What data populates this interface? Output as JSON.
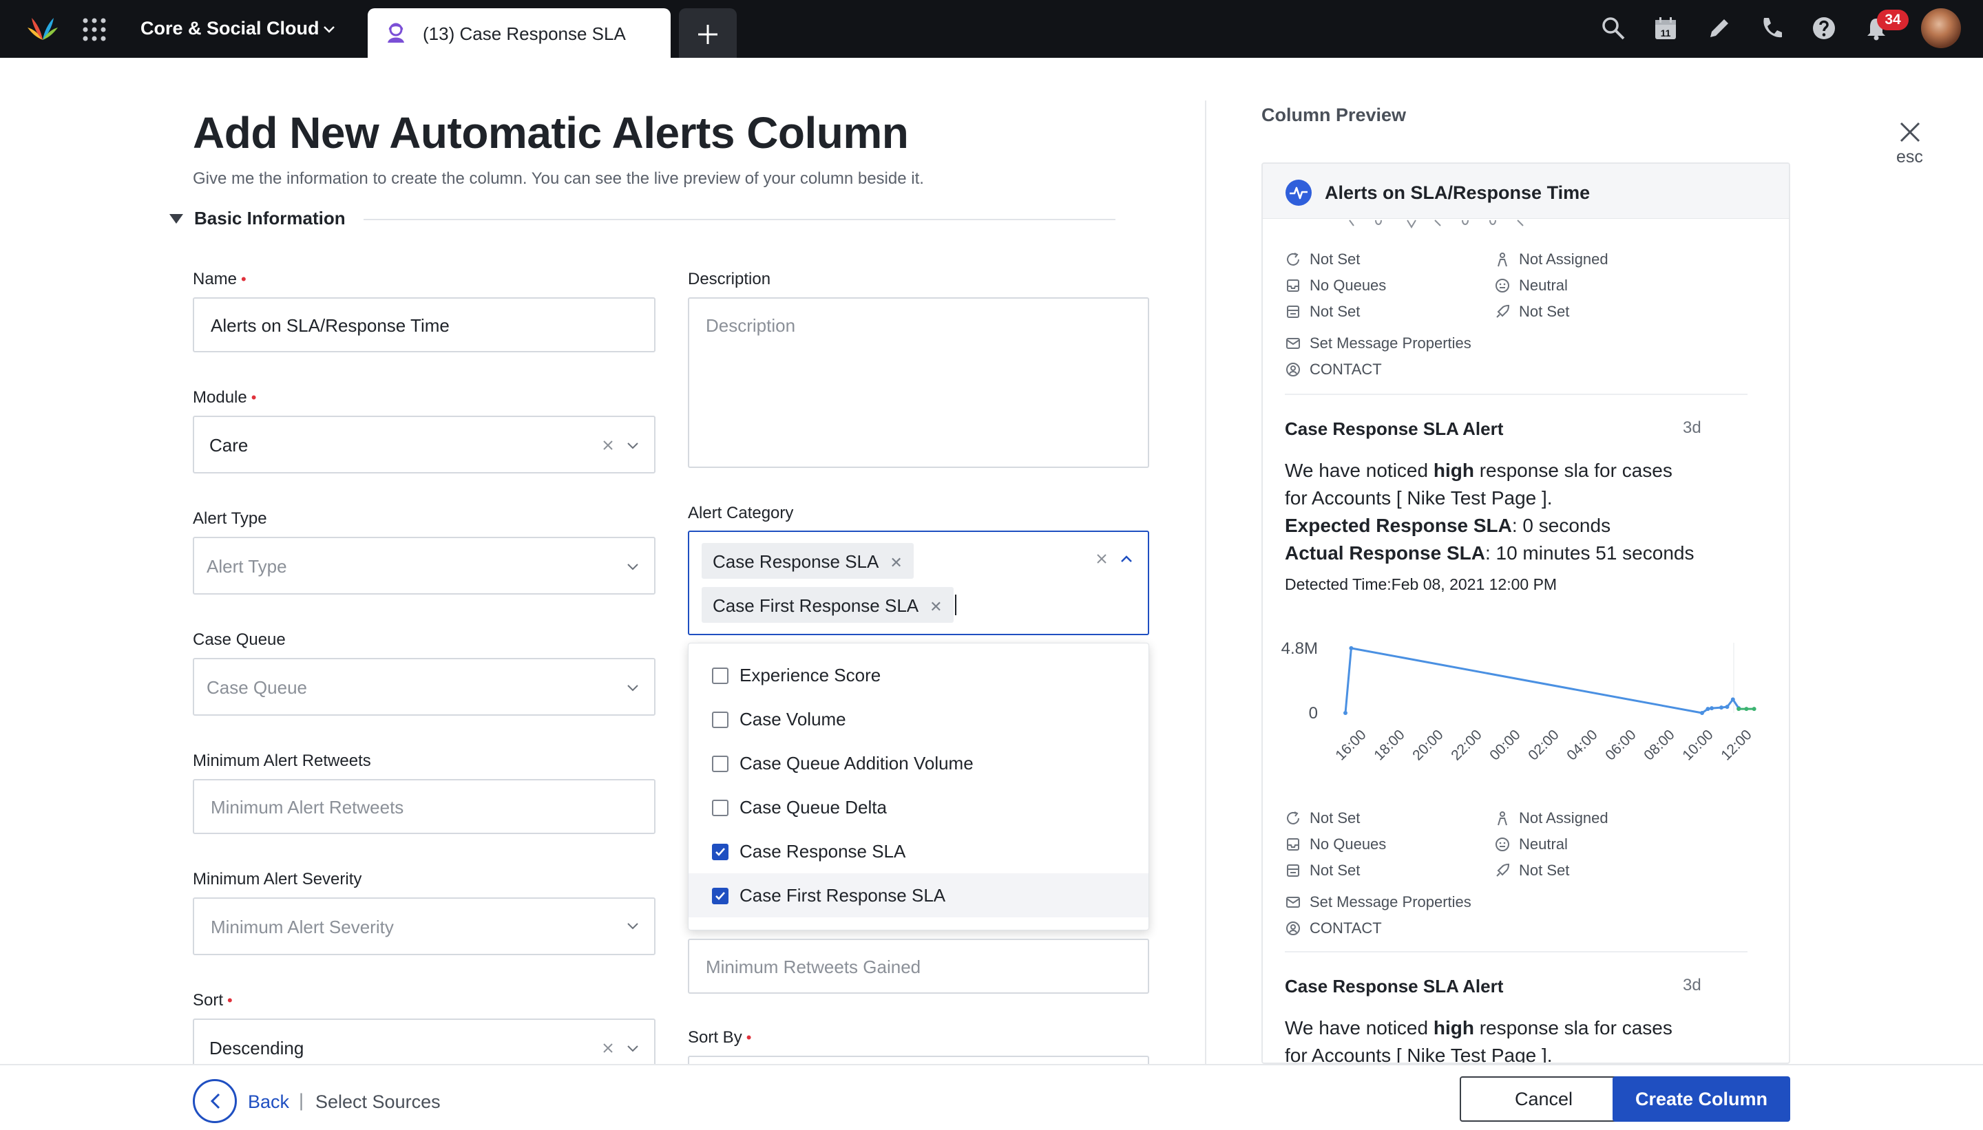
{
  "topbar": {
    "workspace": "Core & Social Cloud",
    "tab_label": "(13) Case Response SLA",
    "notification_count": "34",
    "icons": [
      "search-icon",
      "calendar-icon",
      "pencil-icon",
      "phone-icon",
      "help-icon",
      "bell-icon"
    ],
    "calendar_day": "11"
  },
  "form": {
    "title": "Add New Automatic Alerts Column",
    "subtitle": "Give me the information to create the column. You can see the live preview of your column beside it.",
    "section": "Basic Information",
    "required_mark": "•",
    "name": {
      "label": "Name",
      "value": "Alerts on SLA/Response Time"
    },
    "module": {
      "label": "Module",
      "value": "Care"
    },
    "alert_type": {
      "label": "Alert Type",
      "placeholder": "Alert Type"
    },
    "case_queue": {
      "label": "Case Queue",
      "placeholder": "Case Queue"
    },
    "min_retweets": {
      "label": "Minimum Alert Retweets",
      "placeholder": "Minimum Alert Retweets"
    },
    "min_severity": {
      "label": "Minimum Alert Severity",
      "placeholder": "Minimum Alert Severity"
    },
    "sort": {
      "label": "Sort",
      "value": "Descending"
    },
    "description": {
      "label": "Description",
      "placeholder": "Description"
    },
    "alert_category": {
      "label": "Alert Category",
      "chips": [
        "Case Response SLA",
        "Case First Response SLA"
      ],
      "options": [
        {
          "label": "Experience Score",
          "checked": false
        },
        {
          "label": "Case Volume",
          "checked": false
        },
        {
          "label": "Case Queue Addition Volume",
          "checked": false
        },
        {
          "label": "Case Queue Delta",
          "checked": false
        },
        {
          "label": "Case Response SLA",
          "checked": true
        },
        {
          "label": "Case First Response SLA",
          "checked": true
        }
      ]
    },
    "min_retweets_gained": {
      "placeholder": "Minimum Retweets Gained"
    },
    "sort_by": {
      "label": "Sort By"
    }
  },
  "preview": {
    "heading": "Column Preview",
    "close_label": "esc",
    "card_title": "Alerts on SLA/Response Time",
    "meta_left": [
      "Not Set",
      "No Queues",
      "Not Set"
    ],
    "meta_right": [
      "Not Assigned",
      "Neutral",
      "Not Set"
    ],
    "set_message": "Set Message Properties",
    "contact": "CONTACT",
    "alert": {
      "title": "Case Response SLA Alert",
      "age": "3d",
      "line1_a": "We have noticed ",
      "line1_b": "high",
      "line1_c": " response sla for cases",
      "line2": "for Accounts [ Nike Test Page ].",
      "expected_label": "Expected Response SLA",
      "expected_value": ": 0 seconds",
      "actual_label": "Actual Response SLA",
      "actual_value": ": 10 minutes 51 seconds",
      "detected": "Detected Time:Feb 08, 2021 12:00 PM"
    },
    "alert2": {
      "title": "Case Response SLA Alert",
      "age": "3d",
      "line1_a": "We have noticed ",
      "line1_b": "high",
      "line1_c": " response sla for cases",
      "line2": "for Accounts [ Nike Test Page ]."
    }
  },
  "chart_data": {
    "type": "line",
    "title": "",
    "xlabel": "",
    "ylabel": "",
    "y_ticks": [
      "4.8M",
      "0"
    ],
    "ylim": [
      0,
      5200000
    ],
    "x_ticks": [
      "16:00",
      "18:00",
      "20:00",
      "22:00",
      "00:00",
      "02:00",
      "04:00",
      "06:00",
      "08:00",
      "10:00",
      "12:00"
    ],
    "series": [
      {
        "color": "#4a90e2",
        "x": [
          0,
          0.3,
          18.5,
          18.8,
          19.0,
          19.5,
          19.8,
          20.1,
          20.4
        ],
        "y": [
          0,
          4800000,
          0,
          300000,
          350000,
          400000,
          450000,
          1000000,
          350000
        ]
      },
      {
        "color": "#3cb371",
        "x": [
          20.4,
          20.8,
          21.2
        ],
        "y": [
          300000,
          300000,
          300000
        ]
      }
    ],
    "grid": false
  },
  "footer": {
    "back": "Back",
    "pipe": "|",
    "sources": "Select Sources",
    "cancel": "Cancel",
    "create": "Create Column"
  }
}
